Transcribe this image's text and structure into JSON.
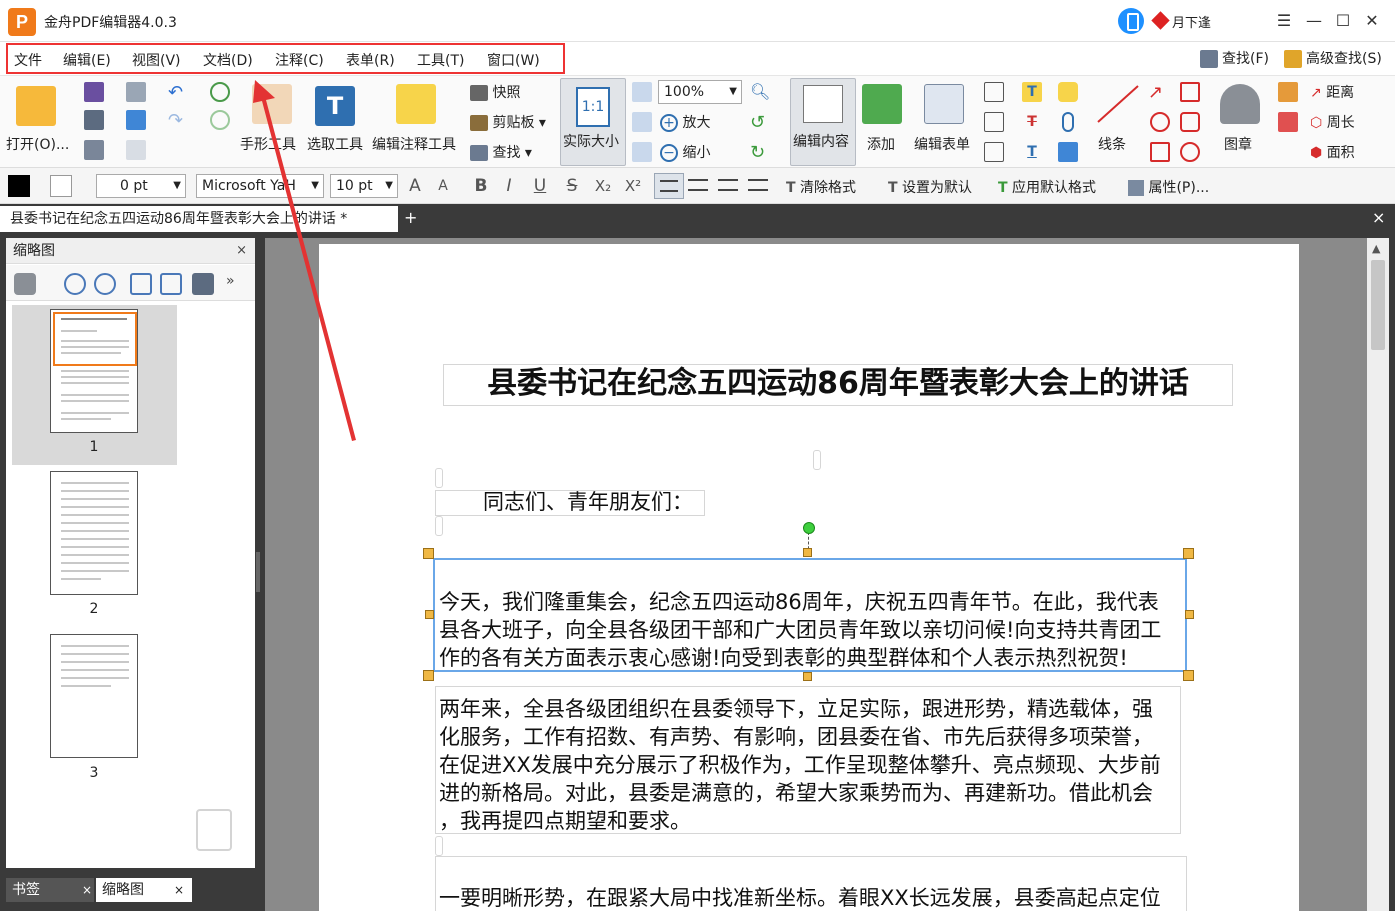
{
  "window": {
    "title": "金舟PDF编辑器4.0.3",
    "user": "月下逢",
    "logo_letter": "P",
    "accent": "#f07a1a",
    "annotation_color": "#e33333"
  },
  "menu": {
    "items": [
      "文件",
      "编辑(E)",
      "视图(V)",
      "文档(D)",
      "注释(C)",
      "表单(R)",
      "工具(T)",
      "窗口(W)"
    ],
    "find": "查找(F)",
    "advanced_find": "高级查找(S)"
  },
  "ribbon": {
    "open": "打开(O)...",
    "snapshot": "快照",
    "clipboard": "剪贴板",
    "find": "查找",
    "hand_tool": "手形工具",
    "select_tool": "选取工具",
    "edit_annotation_tool": "编辑注释工具",
    "actual_size": "实际大小",
    "actual_size_icon": "1:1",
    "zoom_value": "100%",
    "zoom_in": "放大",
    "zoom_out": "缩小",
    "edit_content": "编辑内容",
    "add": "添加",
    "edit_form": "编辑表单",
    "lines": "线条",
    "stamp": "图章",
    "distance": "距离",
    "perimeter": "周长",
    "area": "面积"
  },
  "format": {
    "line_width": "0 pt",
    "font": "Microsoft YaH",
    "font_size": "10 pt",
    "bold": "B",
    "italic": "I",
    "underline": "U",
    "strike": "S",
    "subscript": "X₂",
    "superscript": "X²",
    "grow_font": "A",
    "shrink_font": "A",
    "clear_format": "清除格式",
    "set_default": "设置为默认",
    "apply_default": "应用默认格式",
    "properties": "属性(P)..."
  },
  "tabs": {
    "doc_tab": "县委书记在纪念五四运动86周年暨表彰大会上的讲话 *",
    "add": "+",
    "close": "×"
  },
  "sidebar": {
    "title": "缩略图",
    "close": "×",
    "pages": [
      "1",
      "2",
      "3"
    ],
    "selected_page": 1,
    "bottom_tabs": [
      "书签",
      "缩略图"
    ]
  },
  "document": {
    "title": "县委书记在纪念五四运动86周年暨表彰大会上的讲话",
    "greeting": "同志们、青年朋友们：",
    "para1_lines": [
      "今天，我们隆重集会，纪念五四运动86周年，庆祝五四青年节。在此，我代表",
      "县各大班子，向全县各级团干部和广大团员青年致以亲切问候!向支持共青团工",
      "作的各有关方面表示衷心感谢!向受到表彰的典型群体和个人表示热烈祝贺!"
    ],
    "para2_lines": [
      "两年来，全县各级团组织在县委领导下，立足实际，跟进形势，精选载体，强",
      "化服务，工作有招数、有声势、有影响，团县委在省、市先后获得多项荣誉，",
      "在促进XX发展中充分展示了积极作为，工作呈现整体攀升、亮点频现、大步前",
      "进的新格局。对此，县委是满意的，希望大家乘势而为、再建新功。借此机会",
      "，我再提四点期望和要求。"
    ],
    "para3_line": "一要明晰形势，在跟紧大局中找准新坐标。着眼XX长远发展，县委高起点定位"
  }
}
